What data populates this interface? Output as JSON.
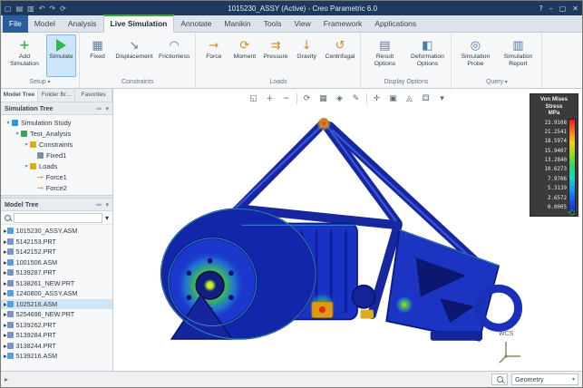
{
  "titlebar": {
    "title": "1015230_ASSY (Active) - Creo Parametric 6.0",
    "quick_icons": [
      {
        "name": "new-file-icon",
        "glyph": "▢"
      },
      {
        "name": "open-file-icon",
        "glyph": "▤"
      },
      {
        "name": "save-icon",
        "glyph": "▥"
      },
      {
        "name": "undo-icon",
        "glyph": "↶"
      },
      {
        "name": "redo-icon",
        "glyph": "↷"
      },
      {
        "name": "regenerate-icon",
        "glyph": "⟳"
      }
    ],
    "window_controls": [
      {
        "name": "help-icon",
        "glyph": "?"
      },
      {
        "name": "minimize-icon",
        "glyph": "–"
      },
      {
        "name": "maximize-icon",
        "glyph": "▢"
      },
      {
        "name": "close-icon",
        "glyph": "✕"
      }
    ]
  },
  "tabs": [
    {
      "label": "File"
    },
    {
      "label": "Model"
    },
    {
      "label": "Analysis"
    },
    {
      "label": "Live Simulation"
    },
    {
      "label": "Annotate"
    },
    {
      "label": "Manikin"
    },
    {
      "label": "Tools"
    },
    {
      "label": "View"
    },
    {
      "label": "Framework"
    },
    {
      "label": "Applications"
    }
  ],
  "ribbon": {
    "buttons": {
      "add_simulation": "Add Simulation",
      "simulate": "Simulate",
      "fixed": "Fixed",
      "displacement": "Displacement",
      "frictionless": "Frictionless",
      "force": "Force",
      "moment": "Moment",
      "pressure": "Pressure",
      "gravity": "Gravity",
      "centrifugal": "Centrifugal",
      "result_options": "Result Options",
      "deformation_options": "Deformation Options",
      "simulation_probe": "Simulation Probe",
      "simulation_report": "Simulation Report"
    },
    "icon_glyphs": {
      "fixed": "▦",
      "displacement": "↘",
      "frictionless": "◠",
      "force": "→",
      "moment": "⟳",
      "pressure": "⇉",
      "gravity": "↓",
      "centrifugal": "↺",
      "result_options": "▤",
      "deformation_options": "◧",
      "simulation_probe": "◎",
      "simulation_report": "▥"
    },
    "groups": {
      "setup": "Setup",
      "constraints": "Constraints",
      "loads": "Loads",
      "display": "Display Options",
      "query": "Query"
    }
  },
  "left_panel": {
    "tabs": [
      {
        "label": "Model Tree"
      },
      {
        "label": "Folder Br..."
      },
      {
        "label": "Favorites"
      }
    ],
    "simulation_tree": {
      "title": "Simulation Tree",
      "items": [
        {
          "label": "Simulation Study"
        },
        {
          "label": "Test_Analysis"
        },
        {
          "label": "Constraints"
        },
        {
          "label": "Fixed1"
        },
        {
          "label": "Loads"
        },
        {
          "label": "Force1"
        },
        {
          "label": "Force2"
        }
      ]
    },
    "model_tree": {
      "title": "Model Tree",
      "search_placeholder": "",
      "items": [
        {
          "label": "1015230_ASSY.ASM"
        },
        {
          "label": "5142153.PRT"
        },
        {
          "label": "5142152.PRT"
        },
        {
          "label": "1001506.ASM"
        },
        {
          "label": "5139287.PRT"
        },
        {
          "label": "5138261_NEW.PRT"
        },
        {
          "label": "1240800_ASSY.ASM"
        },
        {
          "label": "1025216.ASM"
        },
        {
          "label": "5254696_NEW.PRT"
        },
        {
          "label": "5139262.PRT"
        },
        {
          "label": "5139284.PRT"
        },
        {
          "label": "3138244.PRT"
        },
        {
          "label": "5139216.ASM"
        }
      ]
    }
  },
  "graphics_toolbar": {
    "icons": [
      {
        "name": "refit-icon",
        "glyph": "◱"
      },
      {
        "name": "zoom-in-icon",
        "glyph": "+"
      },
      {
        "name": "zoom-out-icon",
        "glyph": "−"
      },
      {
        "name": "repaint-icon",
        "glyph": "⟳"
      },
      {
        "name": "shading-style-icon",
        "glyph": "▦"
      },
      {
        "name": "datum-display-icon",
        "glyph": "◈"
      },
      {
        "name": "annotations-icon",
        "glyph": "✎"
      },
      {
        "name": "spin-center-icon",
        "glyph": "✛"
      },
      {
        "name": "view-manager-icon",
        "glyph": "▣"
      },
      {
        "name": "perspective-icon",
        "glyph": "◬"
      },
      {
        "name": "capture-icon",
        "glyph": "⚃"
      },
      {
        "name": "display-options-icon",
        "glyph": "▾"
      }
    ]
  },
  "legend": {
    "title_line1": "Von Mises Stress",
    "title_line2": "MPa",
    "values": [
      "23.9108",
      "21.2541",
      "18.5974",
      "15.9407",
      "13.2840",
      "10.6273",
      "7.9706",
      "5.3139",
      "2.6572",
      "0.0005"
    ],
    "colors": [
      "#e81e1e",
      "#f07818",
      "#f0d518",
      "#9fd818",
      "#2ed85e",
      "#18d8c0",
      "#18a0e8",
      "#1858e8",
      "#2020c8"
    ],
    "refresh_glyph": "⟲"
  },
  "graphics": {
    "wcs_label": "WCS"
  },
  "status_bar": {
    "select_icon_glyph": "▸",
    "filter_value": "Geometry"
  }
}
